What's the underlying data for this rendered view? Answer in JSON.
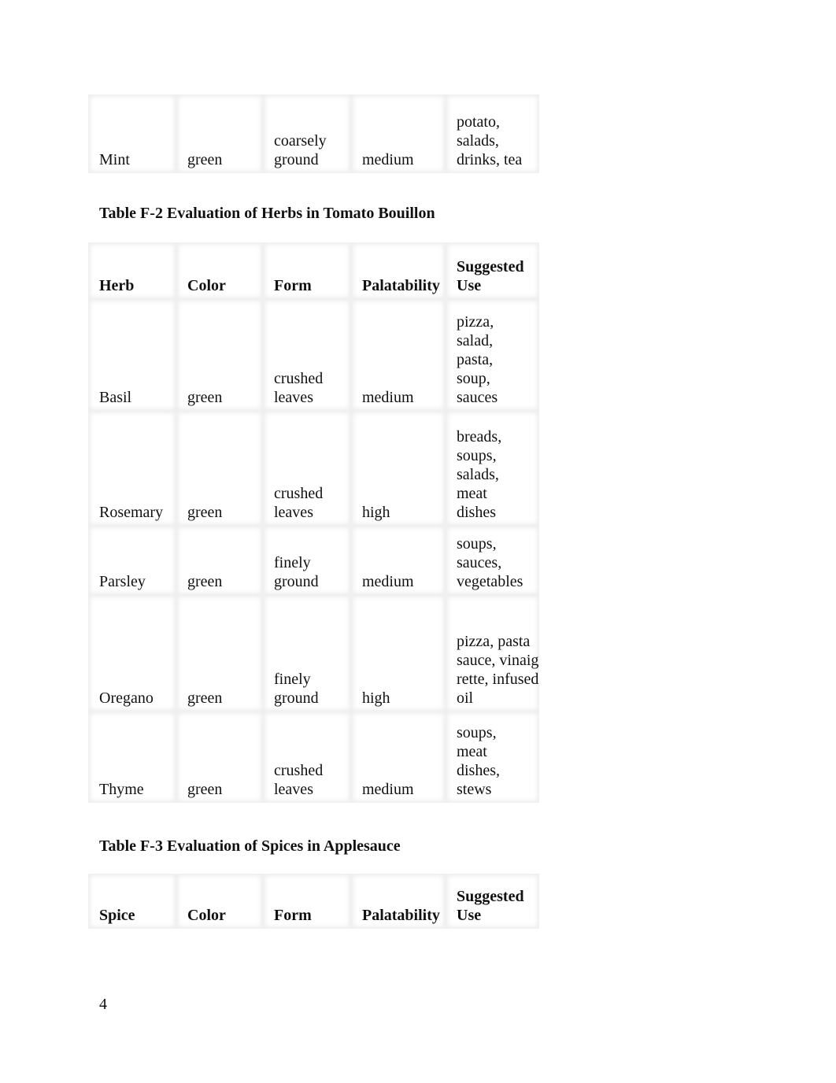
{
  "table_f1_continued": {
    "rows": [
      [
        "Mint",
        "green",
        "coarsely ground",
        "medium",
        "potato, salads, drinks, tea"
      ]
    ]
  },
  "table_f2": {
    "caption": "Table F-2 Evaluation of Herbs in Tomato Bouillon",
    "headers": [
      "Herb",
      "Color",
      "Form",
      "Palatability",
      "Suggested Use"
    ],
    "rows": [
      [
        "Basil",
        "green",
        "crushed leaves",
        "medium",
        "pizza, salad, pasta, soup, sauces"
      ],
      [
        "Rosemary",
        "green",
        "crushed leaves",
        "high",
        "breads, soups, salads, meat dishes"
      ],
      [
        "Parsley",
        "green",
        "finely ground",
        "medium",
        "soups, sauces, vegetables"
      ],
      [
        "Oregano",
        "green",
        "finely ground",
        "high",
        "pizza, pasta sauce, vinaigrette, infused oil"
      ],
      [
        "Thyme",
        "green",
        "crushed leaves",
        "medium",
        "soups, meat dishes, stews"
      ]
    ]
  },
  "table_f3": {
    "caption": "Table F-3 Evaluation of Spices in Applesauce",
    "headers": [
      "Spice",
      "Color",
      "Form",
      "Palatability",
      "Suggested Use"
    ]
  },
  "page_number": "4"
}
